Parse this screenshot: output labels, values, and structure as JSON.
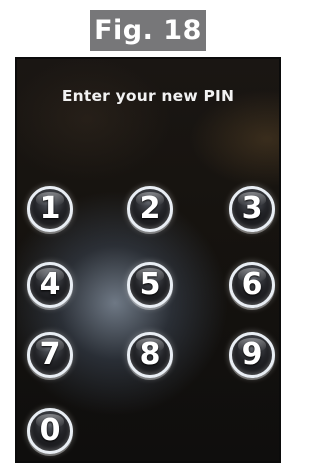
{
  "figure": {
    "label": "Fig. 18"
  },
  "screen": {
    "prompt": "Enter your new PIN"
  },
  "keypad": {
    "keys": [
      "1",
      "2",
      "3",
      "4",
      "5",
      "6",
      "7",
      "8",
      "9",
      "0"
    ]
  },
  "colors": {
    "figure_tag_background": "#777779",
    "screen_background": "#16130f",
    "key_ring": "#e9eef4",
    "text": "#ffffff"
  }
}
